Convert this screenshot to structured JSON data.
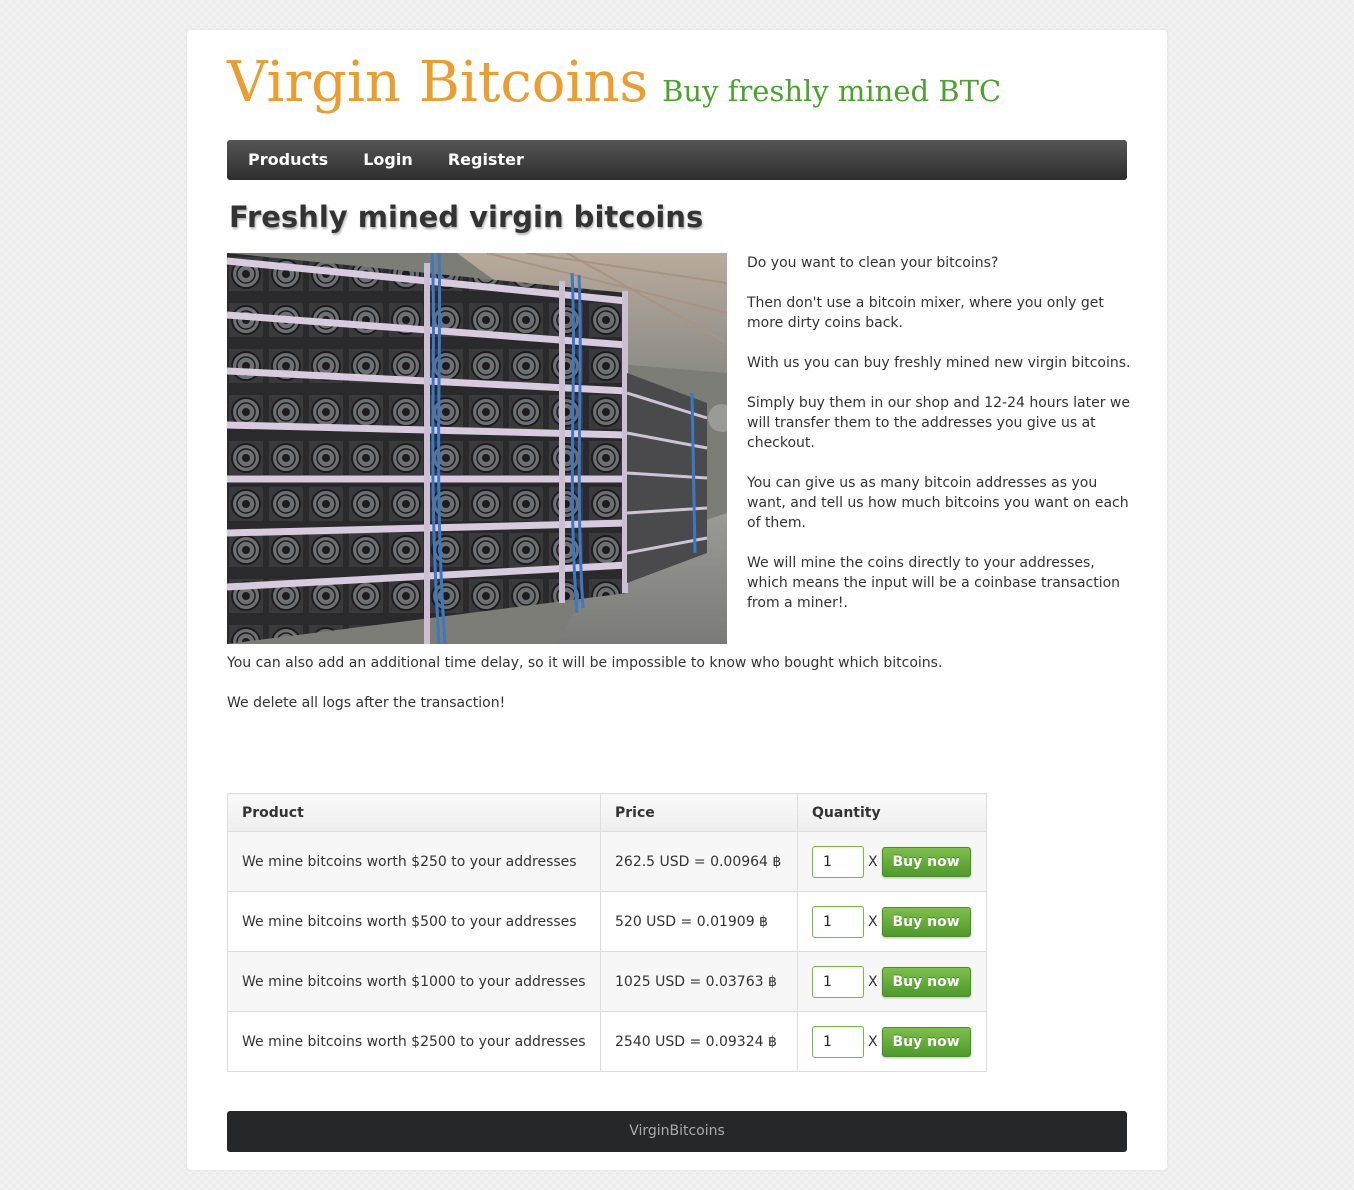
{
  "header": {
    "logo": "Virgin Bitcoins",
    "tagline": "Buy freshly mined BTC"
  },
  "nav": {
    "items": [
      "Products",
      "Login",
      "Register"
    ]
  },
  "main": {
    "title": "Freshly mined virgin bitcoins",
    "hero_image_alt": "Bitcoin mining farm with racks of ASIC miners",
    "intro": [
      "Do you want to clean your bitcoins?",
      "Then don't use a bitcoin mixer, where you only get more dirty coins back.",
      "With us you can buy freshly mined new virgin bitcoins.",
      "Simply buy them in our shop and 12-24 hours later we will transfer them to the addresses you give us at checkout.",
      "You can give us as many bitcoin addresses as you want, and tell us how much bitcoins you want on each of them.",
      "We will mine the coins directly to your addresses, which means the input will be a coinbase transaction from a miner!."
    ],
    "below": [
      "You can also add an additional time delay, so it will be impossible to know who bought which bitcoins.",
      "We delete all logs after the transaction!"
    ]
  },
  "products": {
    "headers": [
      "Product",
      "Price",
      "Quantity"
    ],
    "rows": [
      {
        "product": "We mine bitcoins worth $250 to your addresses",
        "price": "262.5 USD = 0.00964 ฿",
        "quantity": "1"
      },
      {
        "product": "We mine bitcoins worth $500 to your addresses",
        "price": "520 USD = 0.01909 ฿",
        "quantity": "1"
      },
      {
        "product": "We mine bitcoins worth $1000 to your addresses",
        "price": "1025 USD = 0.03763 ฿",
        "quantity": "1"
      },
      {
        "product": "We mine bitcoins worth $2500 to your addresses",
        "price": "2540 USD = 0.09324 ฿",
        "quantity": "1"
      }
    ],
    "multiply_label": "X",
    "buy_label": "Buy now"
  },
  "footer": {
    "text": "VirginBitcoins"
  },
  "colors": {
    "logo_orange": "#ec9d2c",
    "tagline_green": "#4aa42c",
    "nav_dark": "#333333",
    "button_green": "#62ad39",
    "footer_dark": "#262728"
  }
}
